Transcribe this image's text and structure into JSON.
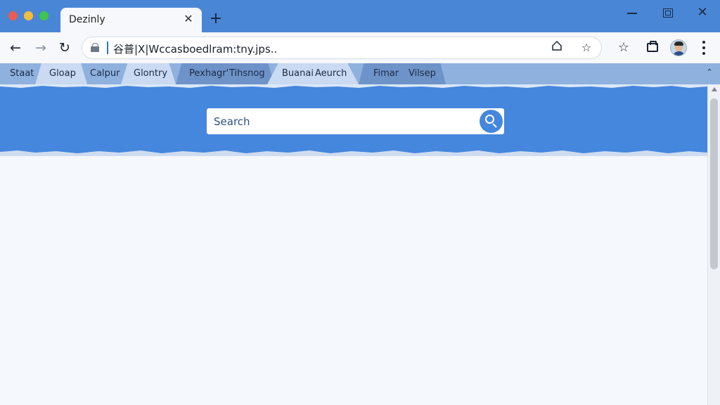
{
  "window": {
    "tab_title": "Dezinly",
    "tab_close": "✕",
    "new_tab": "+",
    "close": "✕"
  },
  "toolbar": {
    "back": "←",
    "forward": "→",
    "reload": "↻",
    "url": "谷普|X|Wccasboedlram:tny.jps..",
    "star": "☆"
  },
  "bookmarks": [
    {
      "label": "Staat"
    },
    {
      "label": "Gloap"
    },
    {
      "label": "Calpur"
    },
    {
      "label": "Glontry"
    },
    {
      "label": "Pexhagr'"
    },
    {
      "label": "Tihsnog"
    },
    {
      "label": "Buanai"
    },
    {
      "label": "Aeurch"
    },
    {
      "label": "Fimar"
    },
    {
      "label": "Vilsep"
    }
  ],
  "bookmarks_overflow": "⌃",
  "search": {
    "placeholder": "Search"
  },
  "colors": {
    "titlebar": "#4a86d6",
    "hero": "#4487dd",
    "bookmarks_bar": "#8fb1de",
    "page_bg": "#f5f8fc"
  }
}
